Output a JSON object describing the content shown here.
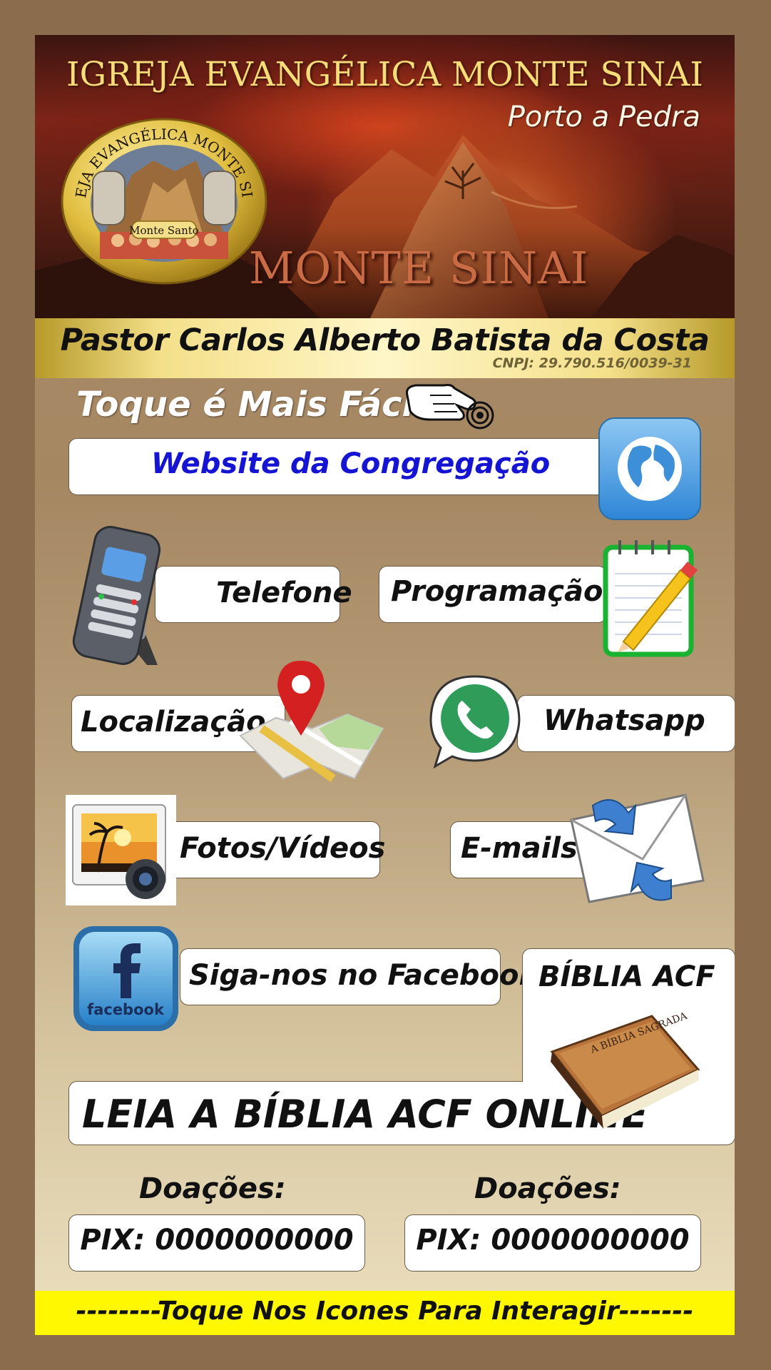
{
  "header": {
    "church_name": "IGREJA EVANGÉLICA MONTE SINAI",
    "location": "Porto a Pedra",
    "banner_text": "MONTE SINAI",
    "logo": {
      "ring_text": "IGREJA EVANGÉLICA MONTE SINAI",
      "inner_text": "Monte Santo"
    }
  },
  "pastor": {
    "name": "Pastor Carlos Alberto Batista da Costa",
    "cnpj": "CNPJ: 29.790.516/0039-31"
  },
  "touch_title": "Toque é Mais Fácil",
  "buttons": {
    "website": "Website da Congregação",
    "telefone": "Telefone",
    "programacao": "Programação",
    "localizacao": "Localização",
    "whatsapp": "Whatsapp",
    "fotos": "Fotos/Vídeos",
    "emails": "E-mails",
    "facebook": "Siga-nos no Facebook",
    "facebook_icon_text": "facebook",
    "biblia_title": "BÍBLIA ACF",
    "biblia_cover_text": "A BÍBLIA SAGRADA",
    "leia_biblia": "LEIA A BÍBLIA ACF ONLINE"
  },
  "donations": [
    {
      "label": "Doações:",
      "pix": "PIX: 0000000000"
    },
    {
      "label": "Doações:",
      "pix": "PIX: 0000000000"
    }
  ],
  "footer": "--------Toque Nos Icones Para Interagir-------",
  "icons": {
    "hand": "pointing-hand-icon",
    "globe": "globe-icon",
    "phone": "phone-icon",
    "notepad": "notepad-pencil-icon",
    "map": "map-pin-icon",
    "whatsapp": "whatsapp-icon",
    "photo": "photo-camera-icon",
    "mail": "mail-arrows-icon",
    "facebook": "facebook-icon",
    "bible": "bible-book-icon"
  },
  "colors": {
    "page_bg": "#8b6d4d",
    "website_text": "#1414d2",
    "footer_bg": "#fff800",
    "gold": "#f4e08a"
  }
}
